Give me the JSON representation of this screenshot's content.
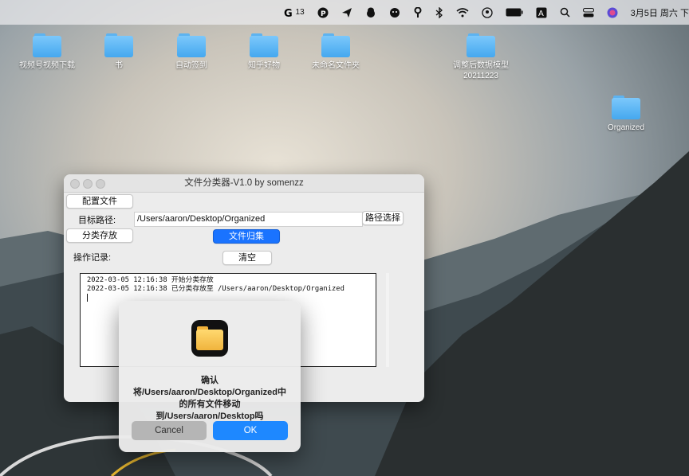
{
  "menubar": {
    "badge_count": "13",
    "clock": "3月5日 周六 下"
  },
  "desktop": {
    "icons": [
      {
        "label": "视频号视频下载"
      },
      {
        "label": "书"
      },
      {
        "label": "自动签到"
      },
      {
        "label": "知乎好物"
      },
      {
        "label": "未命名文件夹"
      },
      {
        "label": "调整后数据模型\n20211223"
      },
      {
        "label": "Organized"
      }
    ]
  },
  "window": {
    "title": "文件分类器-V1.0 by somenzz",
    "config_button": "配置文件",
    "target_label": "目标路径:",
    "target_path": "/Users/aaron/Desktop/Organized",
    "browse_button": "路径选择",
    "classify_button": "分类存放",
    "gather_button": "文件归集",
    "log_label": "操作记录:",
    "clear_button": "清空",
    "log_lines": [
      "2022-03-05 12:16:38 开始分类存放",
      "2022-03-05 12:16:38 已分类存放至 /Users/aaron/Desktop/Organized"
    ]
  },
  "dialog": {
    "message": "确认将/Users/aaron/Desktop/Organized中的所有文件移动到/Users/aaron/Desktop吗",
    "cancel": "Cancel",
    "ok": "OK"
  },
  "colors": {
    "accent": "#1a73ff",
    "folder": "#45a8ef"
  }
}
